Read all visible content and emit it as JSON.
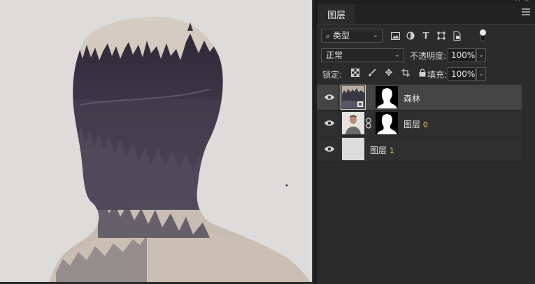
{
  "panel": {
    "tab_title": "图层",
    "filter": {
      "selected": "类型"
    },
    "blend_mode": "正常",
    "opacity": {
      "label": "不透明度:",
      "value": "100%"
    },
    "lock": {
      "label": "锁定:"
    },
    "fill": {
      "label": "填充:",
      "value": "100%"
    }
  },
  "layers": [
    {
      "name": "森林",
      "suffix": "",
      "visible": true,
      "selected": true,
      "has_mask": true,
      "linked_mask": false,
      "thumbnail": "forest-thumbnail"
    },
    {
      "name": "图层 ",
      "suffix": "0",
      "visible": true,
      "selected": false,
      "has_mask": true,
      "linked_mask": true,
      "thumbnail": "portrait-thumbnail"
    },
    {
      "name": "图层 ",
      "suffix": "1",
      "visible": true,
      "selected": false,
      "has_mask": false,
      "linked_mask": false,
      "thumbnail": "blank-thumbnail"
    }
  ],
  "colors": {
    "canvas_background": "#dedcda",
    "silhouette_light": "#c9bfb6",
    "silhouette_dark": "#3a3545",
    "panel_background": "#2b2b2b",
    "selected_layer": "#444444"
  }
}
